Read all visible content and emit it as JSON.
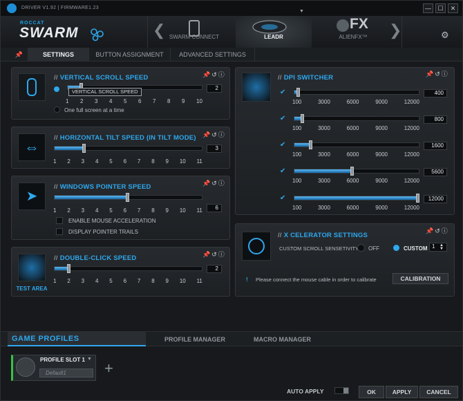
{
  "titlebar": {
    "version": "DRIVER V1.92 | FIRMWARE1.23",
    "minimize": "—",
    "maximize": "☐",
    "close": "✕"
  },
  "header": {
    "brand_small": "ROCCAT",
    "brand_big": "SWARM",
    "devices": [
      {
        "label": "SWARM CONNECT"
      },
      {
        "label": "LEADR"
      },
      {
        "label": "ALIENFX™"
      }
    ],
    "fx_text": "FX"
  },
  "tabs": [
    {
      "label": "SETTINGS"
    },
    {
      "label": "BUTTON ASSIGNMENT"
    },
    {
      "label": "ADVANCED SETTINGS"
    }
  ],
  "vertical_scroll": {
    "title": "VERTICAL SCROLL SPEED",
    "tooltip": "VERTICAL SCROLL SPEED",
    "ticks": [
      "1",
      "2",
      "3",
      "4",
      "5",
      "6",
      "7",
      "8",
      "9",
      "10"
    ],
    "value": "2",
    "option": "One full screen at a time",
    "level": 0.11
  },
  "horizontal_tilt": {
    "title": "HORIZONTAL TILT SPEED (IN TILT MODE)",
    "ticks": [
      "1",
      "2",
      "3",
      "4",
      "5",
      "6",
      "7",
      "8",
      "9",
      "10",
      "11"
    ],
    "value": "3",
    "level": 0.2
  },
  "pointer_speed": {
    "title": "WINDOWS POINTER SPEED",
    "ticks": [
      "1",
      "2",
      "3",
      "4",
      "5",
      "6",
      "7",
      "8",
      "9",
      "10",
      "11"
    ],
    "value": "6",
    "accel_label": "ENABLE MOUSE ACCELERATION",
    "trails_label": "DISPLAY POINTER TRAILS",
    "level": 0.5
  },
  "double_click": {
    "title": "DOUBLE-CLICK SPEED",
    "ticks": [
      "1",
      "2",
      "3",
      "4",
      "5",
      "6",
      "7",
      "8",
      "9",
      "10",
      "11"
    ],
    "value": "2",
    "test_area": "TEST AREA",
    "level": 0.1
  },
  "dpi": {
    "title": "DPI SWITCHER",
    "ticks": [
      "100",
      "3000",
      "6000",
      "9000",
      "12000"
    ],
    "rows": [
      {
        "value": "400",
        "level": 0.025
      },
      {
        "value": "800",
        "level": 0.058
      },
      {
        "value": "1600",
        "level": 0.126
      },
      {
        "value": "5600",
        "level": 0.462
      },
      {
        "value": "12000",
        "level": 1.0
      }
    ]
  },
  "xcelerator": {
    "title": "X CELERATOR SETTINGS",
    "label": "CUSTOM SCROLL SENSETIVITY",
    "off": "OFF",
    "custom": "CUSTOM",
    "custom_value": "1",
    "warning": "Please connect the mouse cable in order to calibrate",
    "calibration": "CALIBRATION"
  },
  "profiles": {
    "title": "GAME PROFILES",
    "manager": "PROFILE MANAGER",
    "macro": "MACRO MANAGER",
    "slot_name": "PROFILE SLOT 1",
    "slot_default": "Default1",
    "add": "+"
  },
  "footer": {
    "auto_apply": "AUTO APPLY",
    "ok": "OK",
    "apply": "APPLY",
    "cancel": "CANCEL"
  }
}
